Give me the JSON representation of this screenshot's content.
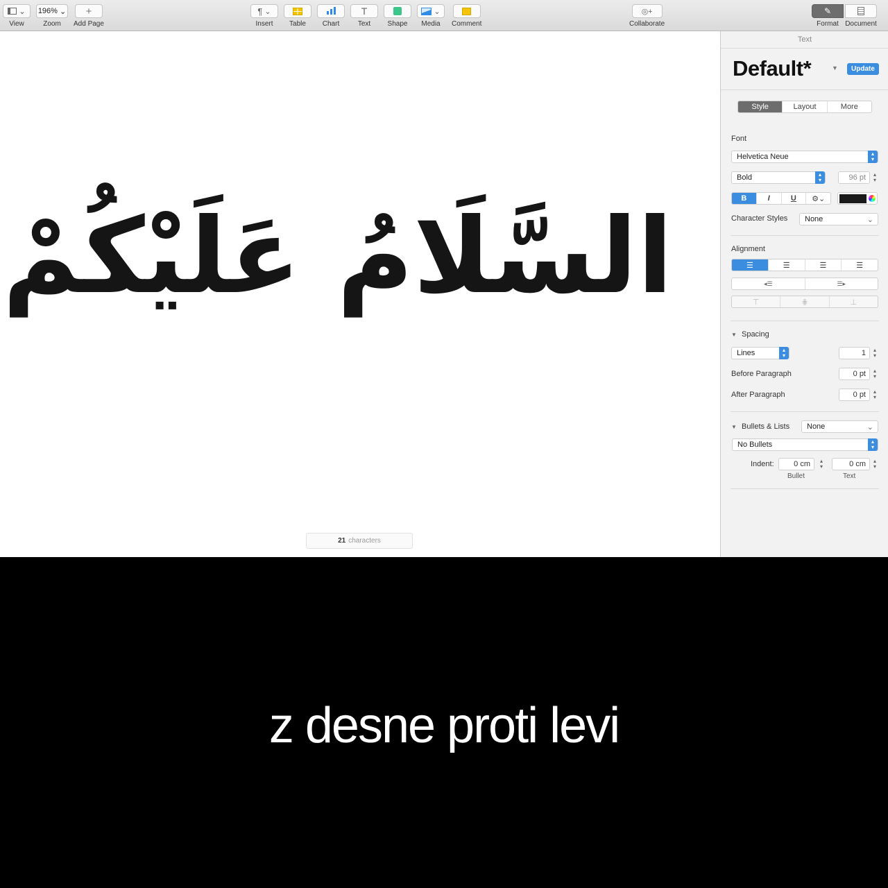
{
  "toolbar": {
    "view": "View",
    "zoom_value": "196%",
    "zoom": "Zoom",
    "add_page": "Add Page",
    "insert": "Insert",
    "table": "Table",
    "chart": "Chart",
    "text": "Text",
    "shape": "Shape",
    "media": "Media",
    "comment": "Comment",
    "collaborate": "Collaborate",
    "format": "Format",
    "document": "Document"
  },
  "canvas": {
    "arabic_text": "السَّلَامُ عَلَيْكُمْ",
    "char_count_num": "21",
    "char_count_label": "characters"
  },
  "sidebar": {
    "header": "Text",
    "style_name": "Default*",
    "update": "Update",
    "tabs": [
      "Style",
      "Layout",
      "More"
    ],
    "font_label": "Font",
    "font_family": "Helvetica Neue",
    "font_style": "Bold",
    "font_size": "96 pt",
    "bold": "B",
    "italic": "I",
    "underline": "U",
    "char_styles_label": "Character Styles",
    "char_styles_value": "None",
    "alignment_label": "Alignment",
    "spacing_label": "Spacing",
    "spacing_mode": "Lines",
    "spacing_value": "1",
    "before_paragraph_label": "Before Paragraph",
    "before_paragraph_value": "0 pt",
    "after_paragraph_label": "After Paragraph",
    "after_paragraph_value": "0 pt",
    "bullets_label": "Bullets & Lists",
    "bullets_value": "None",
    "bullets_type": "No Bullets",
    "indent_label": "Indent:",
    "indent_bullet_value": "0 cm",
    "indent_text_value": "0 cm",
    "indent_bullet_label": "Bullet",
    "indent_text_label": "Text",
    "text_color": "#1a1a1a",
    "accent": "#3b8de0"
  },
  "caption": "z desne proti levi"
}
